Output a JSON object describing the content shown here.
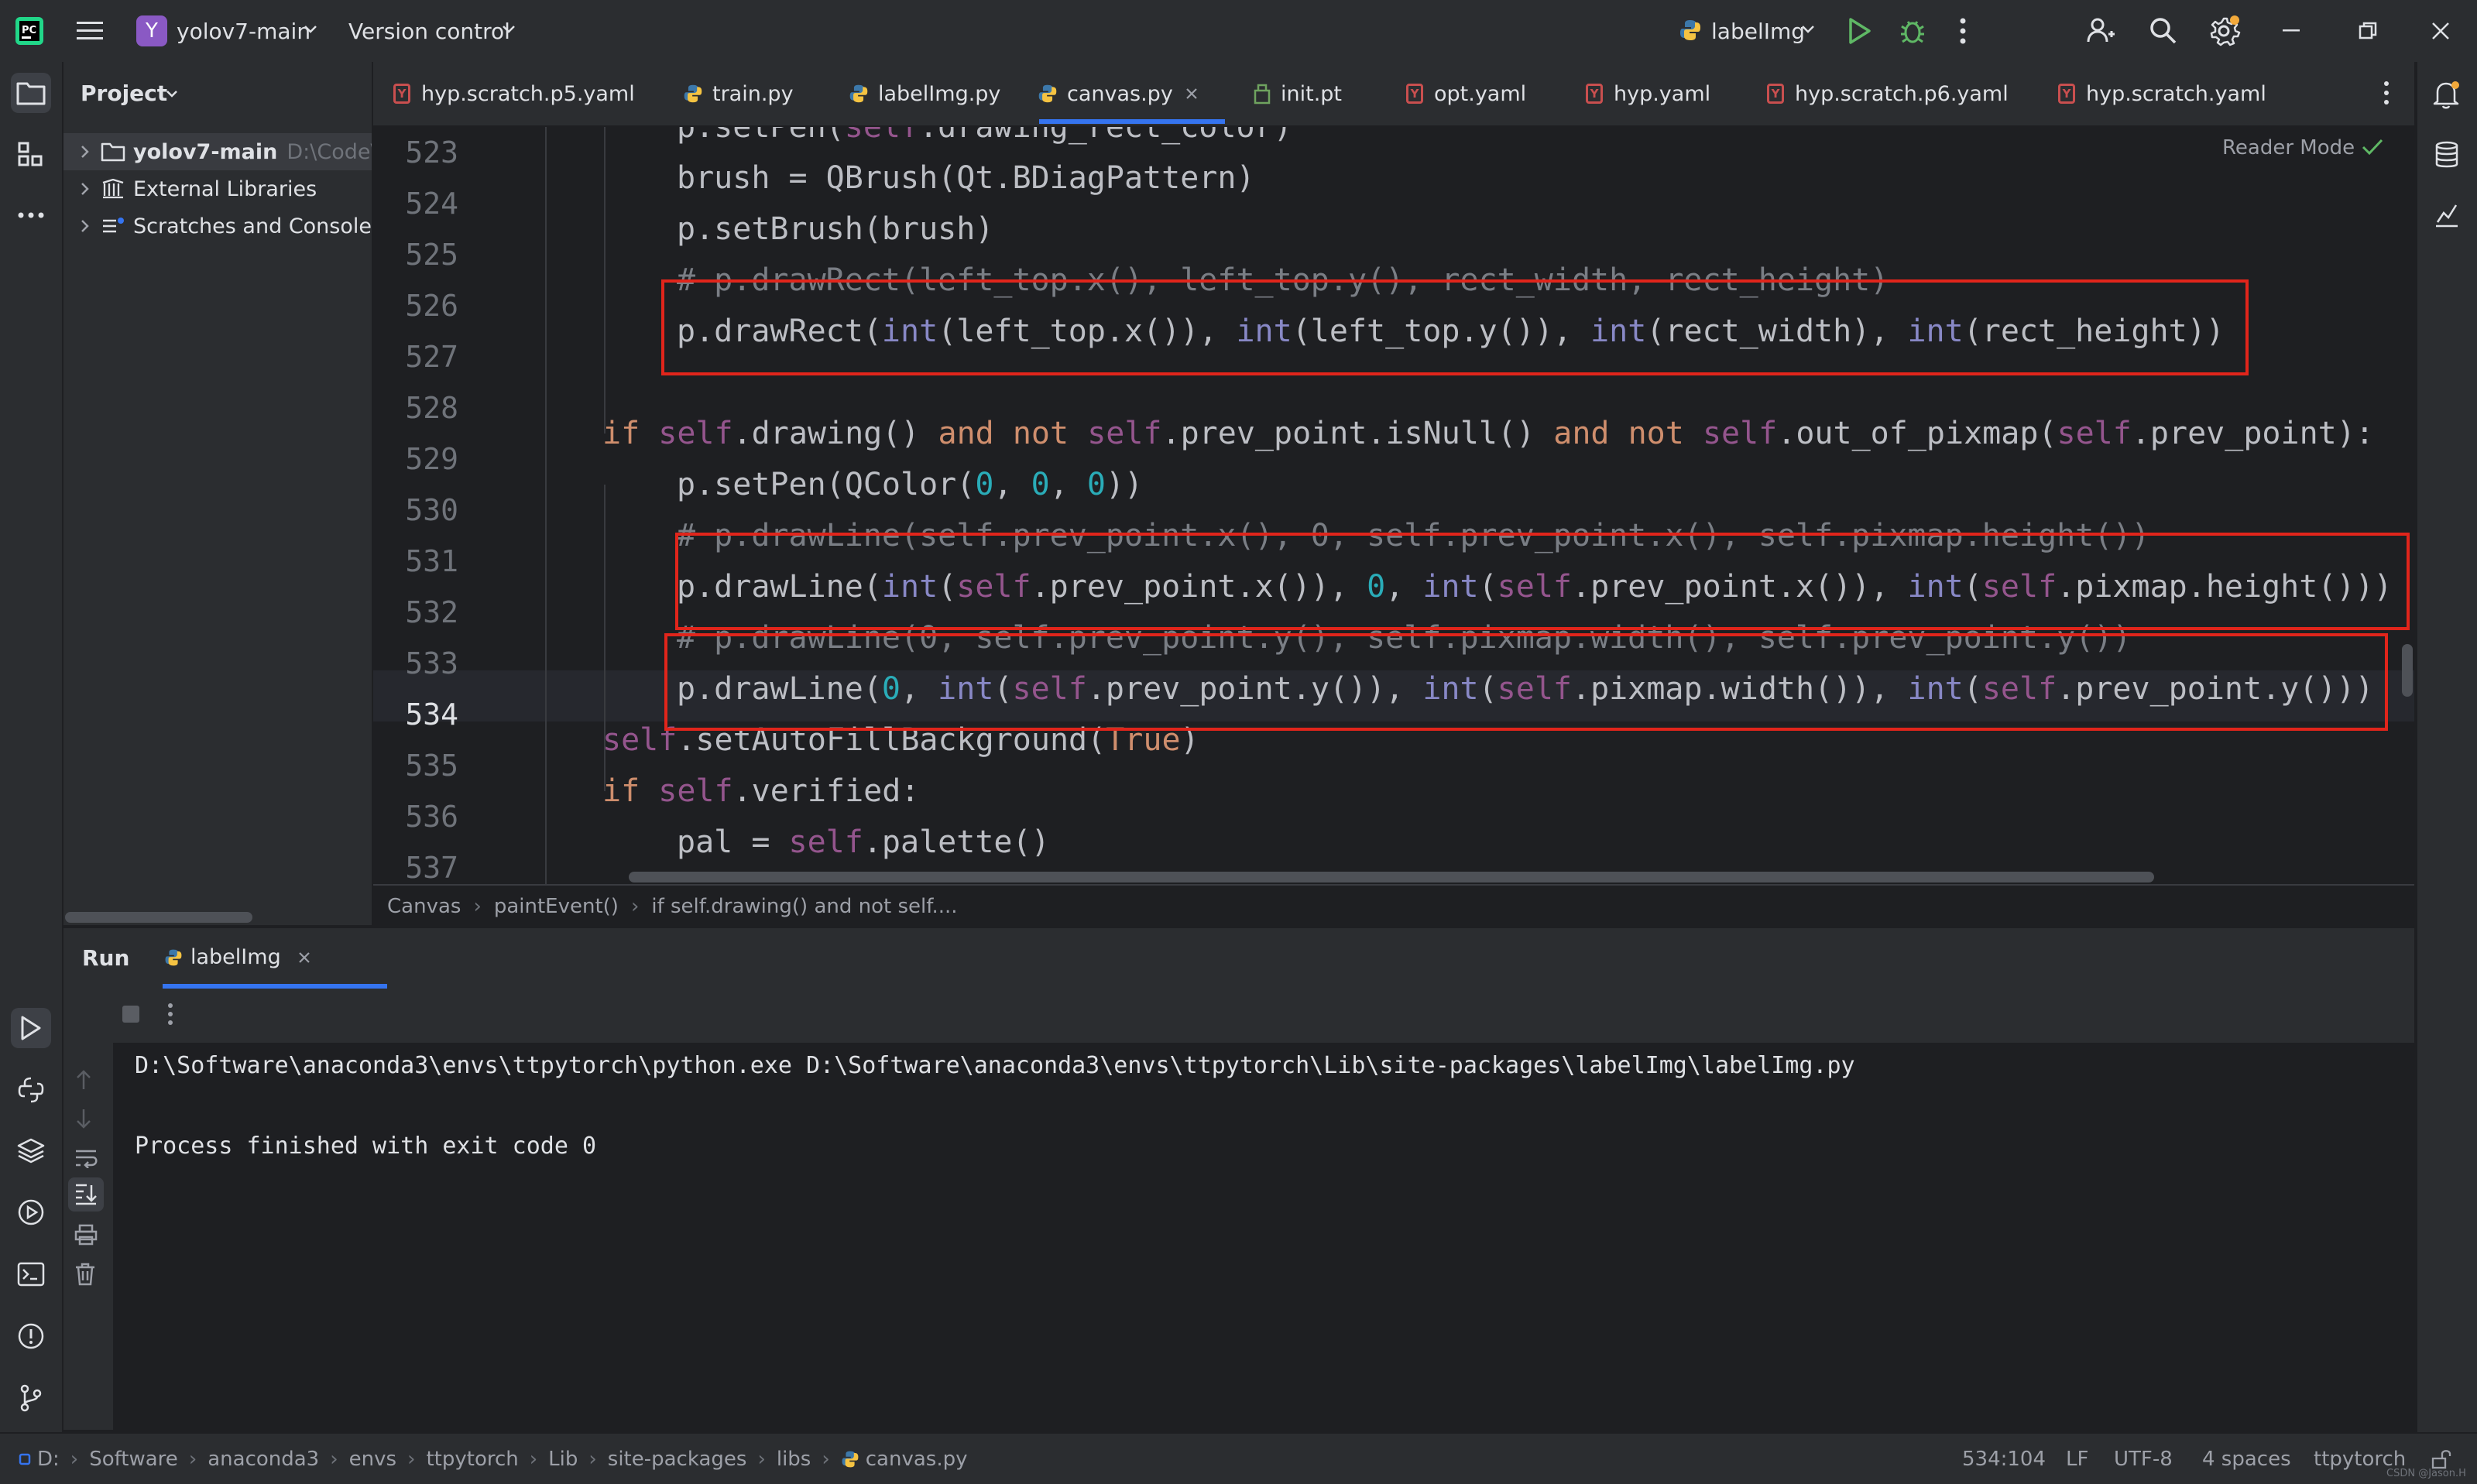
{
  "titlebar": {
    "project_badge": "Y",
    "project_name": "yolov7-main",
    "vcs_label": "Version control",
    "run_config": "labelImg"
  },
  "colors": {
    "accent": "#3574f0",
    "highlight_box": "#e1251b",
    "run_green": "#5fb865",
    "project_badge_bg": "#8a59c4"
  },
  "project_panel": {
    "title": "Project",
    "items": [
      {
        "label": "yolov7-main",
        "path": "D:\\Code\\"
      },
      {
        "label": "External Libraries"
      },
      {
        "label": "Scratches and Consoles"
      }
    ]
  },
  "tabs": [
    {
      "label": "hyp.scratch.p5.yaml",
      "icon": "yaml-icon"
    },
    {
      "label": "train.py",
      "icon": "python-icon"
    },
    {
      "label": "labelImg.py",
      "icon": "python-icon"
    },
    {
      "label": "canvas.py",
      "icon": "python-icon",
      "active": true
    },
    {
      "label": "init.pt",
      "icon": "binary-file-icon"
    },
    {
      "label": "opt.yaml",
      "icon": "yaml-icon"
    },
    {
      "label": "hyp.yaml",
      "icon": "yaml-icon"
    },
    {
      "label": "hyp.scratch.p6.yaml",
      "icon": "yaml-icon"
    },
    {
      "label": "hyp.scratch.yaml",
      "icon": "yaml-icon"
    }
  ],
  "editor": {
    "reader_mode": "Reader Mode",
    "current_line": "534",
    "line_numbers": [
      "523",
      "524",
      "525",
      "526",
      "527",
      "528",
      "529",
      "530",
      "531",
      "532",
      "533",
      "534",
      "535",
      "536",
      "537"
    ]
  },
  "breadcrumb": [
    "Canvas",
    "paintEvent()",
    "if self.drawing() and not self...."
  ],
  "run": {
    "title": "Run",
    "tab_label": "labelImg",
    "command": "D:\\Software\\anaconda3\\envs\\ttpytorch\\python.exe D:\\Software\\anaconda3\\envs\\ttpytorch\\Lib\\site-packages\\labelImg\\labelImg.py",
    "exit_message": "Process finished with exit code 0"
  },
  "status": {
    "path": [
      "D:",
      "Software",
      "anaconda3",
      "envs",
      "ttpytorch",
      "Lib",
      "site-packages",
      "libs",
      "canvas.py"
    ],
    "position": "534:104",
    "line_ending": "LF",
    "encoding": "UTF-8",
    "indent": "4 spaces",
    "interpreter": "ttpytorch",
    "watermark": "CSDN @Jason.H"
  }
}
